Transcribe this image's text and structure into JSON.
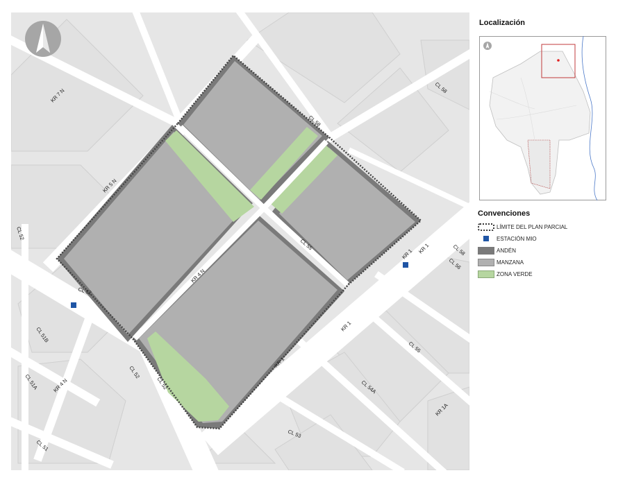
{
  "map": {
    "north_arrow_icon": "north-arrow-icon",
    "streets": [
      {
        "id": "kr7n",
        "text": "KR 7 N"
      },
      {
        "id": "kr5n",
        "text": "KR 5 N"
      },
      {
        "id": "kr4n-center",
        "text": "KR 4 N"
      },
      {
        "id": "kr4n-sw",
        "text": "KR 4 N"
      },
      {
        "id": "cl58-top",
        "text": "CL 58"
      },
      {
        "id": "cl58-block",
        "text": "CL 58"
      },
      {
        "id": "cl58-right",
        "text": "CL 58"
      },
      {
        "id": "cl56",
        "text": "CL 56"
      },
      {
        "id": "cl55-center",
        "text": "CL 55"
      },
      {
        "id": "cl55-se",
        "text": "CL 55"
      },
      {
        "id": "cl54a",
        "text": "CL 54A"
      },
      {
        "id": "cl53",
        "text": "CL 53"
      },
      {
        "id": "cl52-left",
        "text": "CL 52"
      },
      {
        "id": "cl52-mid",
        "text": "CL 52"
      },
      {
        "id": "cl52-sw1",
        "text": "CL 52"
      },
      {
        "id": "cl52-sw2",
        "text": "CL 52"
      },
      {
        "id": "cl51b",
        "text": "CL 51B"
      },
      {
        "id": "cl51a",
        "text": "CL 51A"
      },
      {
        "id": "cl51",
        "text": "CL 51"
      },
      {
        "id": "kr1-a",
        "text": "KR 1"
      },
      {
        "id": "kr1-b",
        "text": "KR 1"
      },
      {
        "id": "kr1-c",
        "text": "KR 1"
      },
      {
        "id": "kr1-d",
        "text": "KR 1"
      },
      {
        "id": "kr1a",
        "text": "KR 1A"
      }
    ],
    "colors": {
      "background": "#e6e6e6",
      "road": "#ffffff",
      "anden": "#7a7a7a",
      "manzana": "#b0b0b0",
      "zona_verde": "#b6d6a0",
      "estacion_mio": "#1f55a5"
    }
  },
  "sidebar": {
    "localizacion_title": "Localización",
    "convenciones_title": "Convenciones",
    "legend": [
      {
        "id": "limite",
        "label": "LÍMITE DEL PLAN PARCIAL"
      },
      {
        "id": "estacion",
        "label": "ESTACIÓN MIO"
      },
      {
        "id": "anden",
        "label": "ANDÉN"
      },
      {
        "id": "manzana",
        "label": "MANZANA"
      },
      {
        "id": "verde",
        "label": "ZONA VERDE"
      }
    ]
  }
}
